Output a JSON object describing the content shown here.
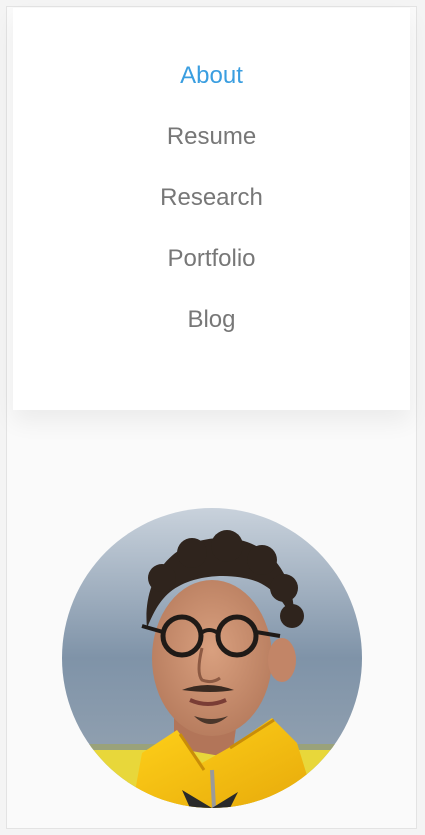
{
  "nav": {
    "items": [
      {
        "label": "About",
        "active": true
      },
      {
        "label": "Resume",
        "active": false
      },
      {
        "label": "Research",
        "active": false
      },
      {
        "label": "Portfolio",
        "active": false
      },
      {
        "label": "Blog",
        "active": false
      }
    ]
  },
  "colors": {
    "accent": "#3a9ee0",
    "nav_text": "#777777",
    "page_background": "#fafafa"
  }
}
